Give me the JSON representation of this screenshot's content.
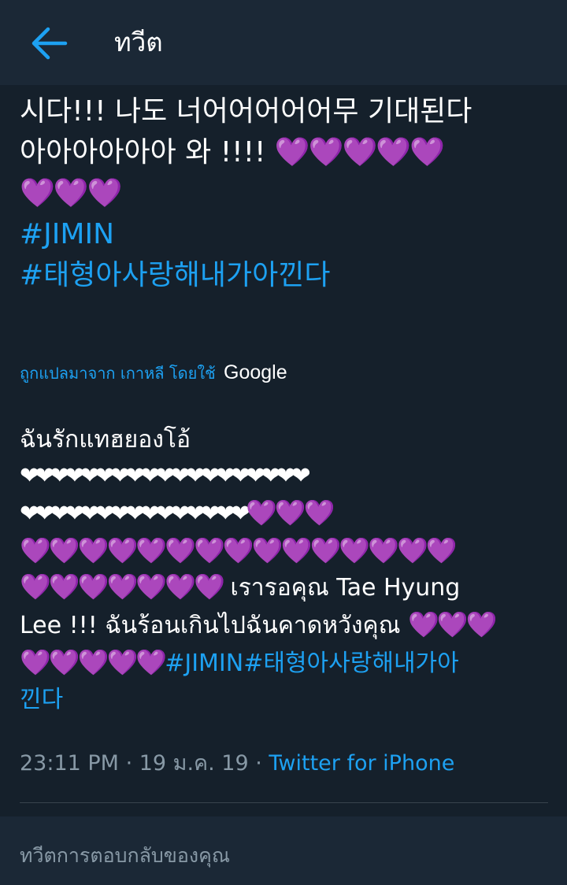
{
  "appbar": {
    "back_icon": "arrow-left-icon",
    "title": "ทวีต"
  },
  "colors": {
    "background": "#15202b",
    "appbar": "#1b2836",
    "link": "#1da1f2",
    "heart_purple": "#7b3fd0",
    "muted": "#8899a6"
  },
  "tweet": {
    "line1_text": "시다!!! 나도 너어어어어어무 기대된다",
    "line2_text": "아아아아아아 와 !!!! ",
    "line2_hearts": "💜💜💜💜💜",
    "line3_hearts": "💜💜💜",
    "hashtag1": "#JIMIN",
    "hashtag2": "#태형아사랑해내가아낀다"
  },
  "translation_note": {
    "text": "ถูกแปลมาจาก เกาหลี โดยใช้",
    "provider": "Google"
  },
  "translation": {
    "t_line1": "ฉันรักแทฮยองโอ้",
    "t_line2_white_hearts": "❤❤❤❤❤❤❤❤❤❤❤❤❤❤❤❤❤❤❤",
    "t_line3_white_hearts": "❤❤❤❤❤❤❤❤❤❤❤❤❤❤❤",
    "t_line3_purple_hearts": "💜💜💜",
    "t_line4_purple_hearts": "💜💜💜💜💜💜💜💜💜💜💜💜💜💜💜",
    "t_line5_purple_hearts": "💜💜💜💜💜💜💜",
    "t_line5_text": " เรารอคุณ Tae Hyung",
    "t_line6_text": "Lee !!! ฉันร้อนเกินไปฉันคาดหวังคุณ ",
    "t_line6_purple_hearts": "💜💜💜",
    "t_line7_purple_hearts": "💜💜💜💜💜",
    "t_line7_hashtags": "#JIMIN#태형아사랑해내가아",
    "t_line8_hashtag_cont": "낀다"
  },
  "meta": {
    "time": "23:11 PM",
    "sep1": " · ",
    "date": "19 ม.ค. 19",
    "sep2": " · ",
    "source": "Twitter for iPhone"
  },
  "reply": {
    "placeholder": "ทวีตการตอบกลับของคุณ"
  }
}
